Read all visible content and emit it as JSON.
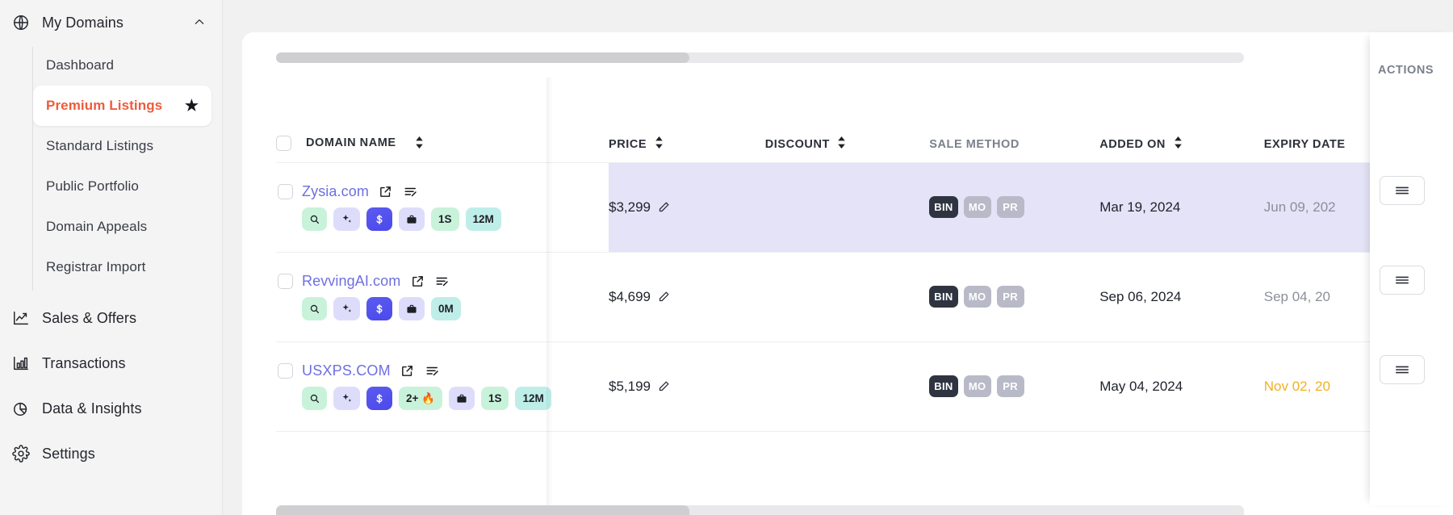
{
  "sidebar": {
    "group": {
      "label": "My Domains",
      "icon": "globe-icon",
      "chevron": "chevron-up-icon"
    },
    "subitems": [
      {
        "label": "Dashboard",
        "active": false
      },
      {
        "label": "Premium Listings",
        "active": true,
        "badge_icon": "star-icon"
      },
      {
        "label": "Standard Listings",
        "active": false
      },
      {
        "label": "Public Portfolio",
        "active": false
      },
      {
        "label": "Domain Appeals",
        "active": false
      },
      {
        "label": "Registrar Import",
        "active": false
      }
    ],
    "mainitems": [
      {
        "label": "Sales & Offers",
        "icon": "trending-up-icon"
      },
      {
        "label": "Transactions",
        "icon": "bar-chart-icon"
      },
      {
        "label": "Data & Insights",
        "icon": "pie-chart-icon"
      },
      {
        "label": "Settings",
        "icon": "gear-icon"
      }
    ]
  },
  "table": {
    "headers": {
      "domain_name": "DOMAIN NAME",
      "price": "PRICE",
      "discount": "DISCOUNT",
      "sale_method": "SALE METHOD",
      "added_on": "ADDED ON",
      "expiry_date": "EXPIRY DATE",
      "actions": "ACTIONS"
    },
    "rows": [
      {
        "domain": "Zysia.com",
        "highlight": true,
        "badges": [
          {
            "type": "icon",
            "icon": "magnifier-icon",
            "style": "b-green"
          },
          {
            "type": "icon",
            "icon": "sparkle-icon",
            "style": "b-lav"
          },
          {
            "type": "icon",
            "icon": "dollar-icon",
            "style": "b-blue"
          },
          {
            "type": "icon",
            "icon": "briefcase-icon",
            "style": "b-lav"
          },
          {
            "type": "text",
            "label": "1S",
            "style": "b-mint"
          },
          {
            "type": "text",
            "label": "12M",
            "style": "b-teal"
          }
        ],
        "price": "$3,299",
        "discount": "",
        "methods": [
          {
            "label": "BIN",
            "active": true
          },
          {
            "label": "MO",
            "active": false
          },
          {
            "label": "PR",
            "active": false
          }
        ],
        "added_on": "Mar 19, 2024",
        "expiry_date": "Jun 09, 202",
        "expiry_warn": false
      },
      {
        "domain": "RevvingAI.com",
        "highlight": false,
        "badges": [
          {
            "type": "icon",
            "icon": "magnifier-icon",
            "style": "b-green"
          },
          {
            "type": "icon",
            "icon": "sparkle-icon",
            "style": "b-lav"
          },
          {
            "type": "icon",
            "icon": "dollar-icon",
            "style": "b-blue"
          },
          {
            "type": "icon",
            "icon": "briefcase-icon",
            "style": "b-lav"
          },
          {
            "type": "text",
            "label": "0M",
            "style": "b-teal"
          }
        ],
        "price": "$4,699",
        "discount": "",
        "methods": [
          {
            "label": "BIN",
            "active": true
          },
          {
            "label": "MO",
            "active": false
          },
          {
            "label": "PR",
            "active": false
          }
        ],
        "added_on": "Sep 06, 2024",
        "expiry_date": "Sep 04, 20",
        "expiry_warn": false
      },
      {
        "domain": "USXPS.COM",
        "highlight": false,
        "badges": [
          {
            "type": "icon",
            "icon": "magnifier-icon",
            "style": "b-green"
          },
          {
            "type": "icon",
            "icon": "sparkle-icon",
            "style": "b-lav"
          },
          {
            "type": "icon",
            "icon": "dollar-icon",
            "style": "b-blue"
          },
          {
            "type": "text",
            "label": "2+ 🔥",
            "style": "b-green"
          },
          {
            "type": "icon",
            "icon": "briefcase-icon",
            "style": "b-lav"
          },
          {
            "type": "text",
            "label": "1S",
            "style": "b-mint"
          },
          {
            "type": "text",
            "label": "12M",
            "style": "b-teal"
          }
        ],
        "price": "$5,199",
        "discount": "",
        "methods": [
          {
            "label": "BIN",
            "active": true
          },
          {
            "label": "MO",
            "active": false
          },
          {
            "label": "PR",
            "active": false
          }
        ],
        "added_on": "May 04, 2024",
        "expiry_date": "Nov 02, 20",
        "expiry_warn": true
      }
    ],
    "row_icons": {
      "open_external": "external-link-icon",
      "notes": "notes-edit-icon",
      "edit_price": "pencil-icon",
      "row_menu": "hamburger-menu-icon"
    }
  },
  "colors": {
    "accent": "#f05a3c",
    "domain_link": "#6d6fe0",
    "row_highlight": "#e4e3f7",
    "badge_blue": "#5b5bf0",
    "warn": "#f2b020"
  }
}
